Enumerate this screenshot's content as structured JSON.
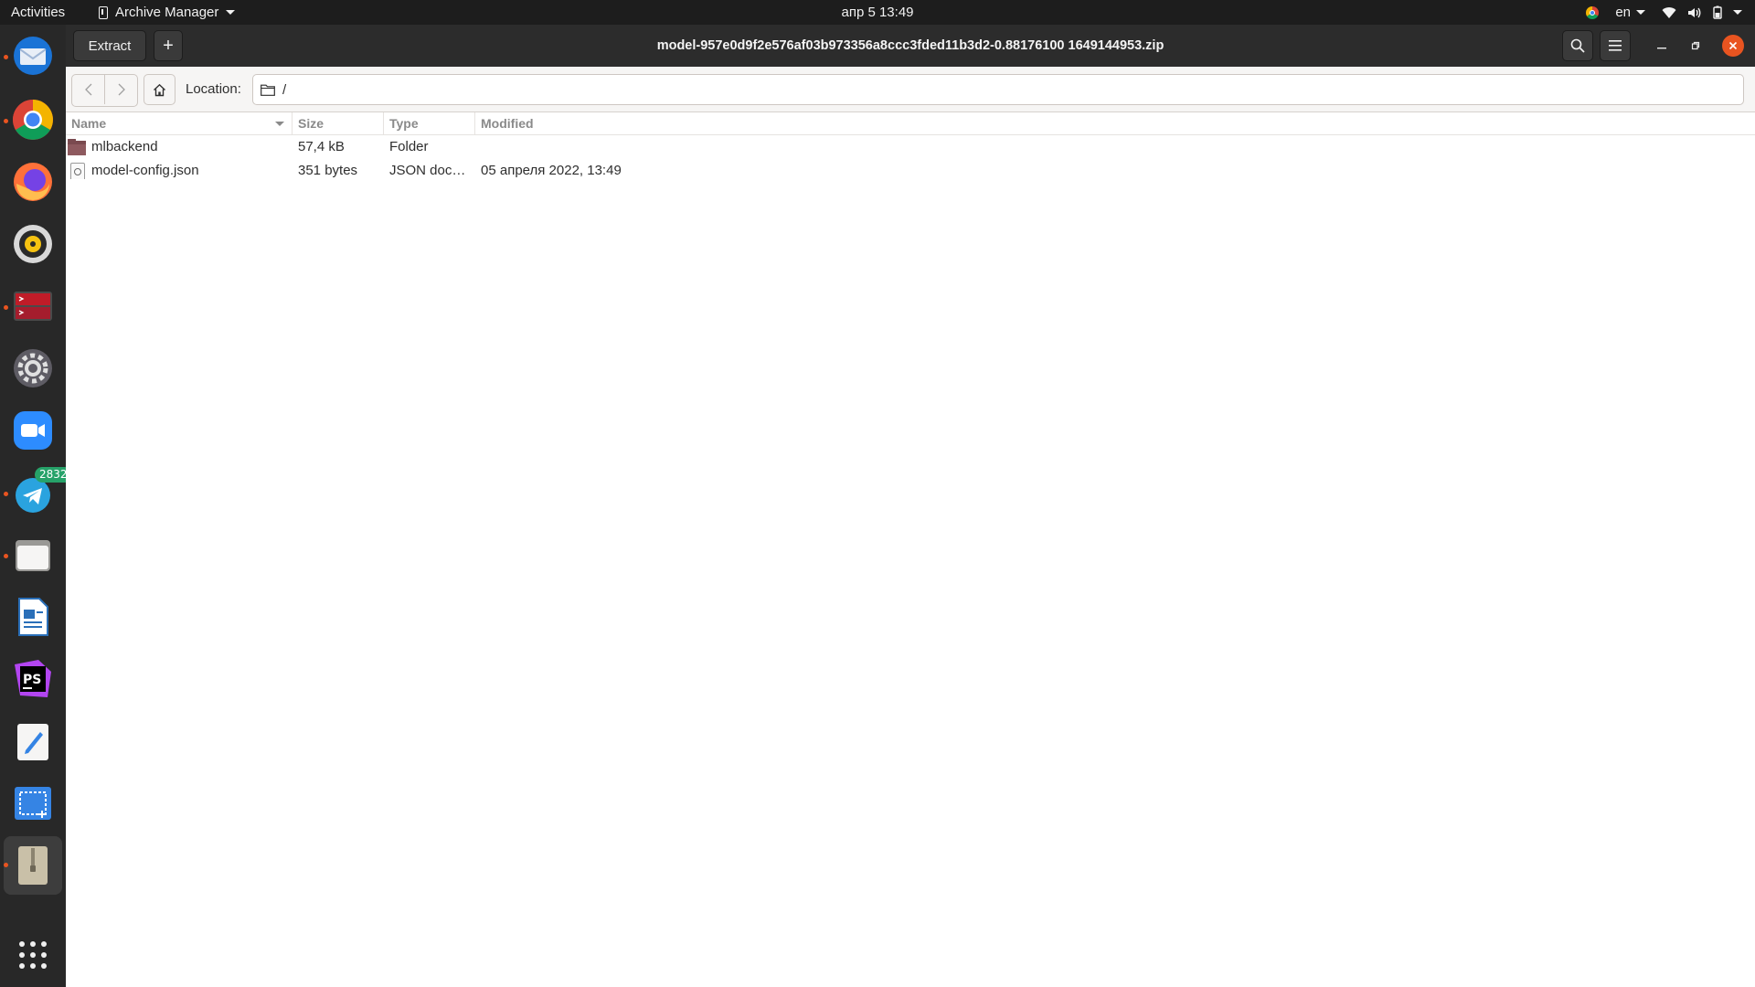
{
  "topbar": {
    "activities": "Activities",
    "app_menu": "Archive Manager",
    "clock": "апр 5  13:49",
    "lang": "en"
  },
  "dock": {
    "apps": [
      "thunderbird-icon",
      "chrome-icon",
      "firefox-icon",
      "rhythmbox-icon",
      "terminal-icon",
      "settings-icon",
      "zoom-icon",
      "telegram-icon",
      "files-icon",
      "writer-icon",
      "phpstorm-icon",
      "text-editor-icon",
      "screenshot-icon",
      "archive-manager-icon"
    ],
    "telegram_badge": "2832"
  },
  "window": {
    "title": "model-957e0d9f2e576af03b973356a8ccc3fded11b3d2-0.88176100 1649144953.zip",
    "extract_label": "Extract",
    "add_label": "+"
  },
  "location": {
    "label": "Location:",
    "path": "/"
  },
  "columns": {
    "name": "Name",
    "size": "Size",
    "type": "Type",
    "modified": "Modified"
  },
  "files": [
    {
      "name": "mlbackend",
      "size": "57,4 kB",
      "type": "Folder",
      "modified": "",
      "icon": "folder-icon"
    },
    {
      "name": "model-config.json",
      "size": "351 bytes",
      "type": "JSON docu…",
      "modified": "05 апреля 2022, 13:49",
      "icon": "json-file-icon"
    }
  ],
  "colors": {
    "accent": "#e95420",
    "topbar_bg": "#1d1d1d",
    "dock_bg": "#282828",
    "header_bg": "#2c2c2c"
  }
}
